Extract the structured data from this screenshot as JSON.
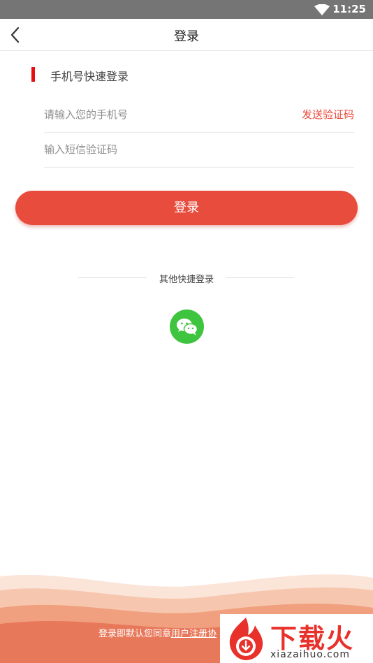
{
  "status_bar": {
    "time": "11:25",
    "wifi_icon": "wifi-icon"
  },
  "header": {
    "title": "登录",
    "back_icon": "back-arrow-icon"
  },
  "section": {
    "title": "手机号快速登录",
    "marker_color": "#e80e0e"
  },
  "form": {
    "phone_placeholder": "请输入您的手机号",
    "phone_value": "",
    "send_code_label": "发送验证码",
    "code_placeholder": "输入短信验证码",
    "code_value": ""
  },
  "login_button": {
    "label": "登录",
    "color": "#e84c3d"
  },
  "other_login": {
    "title": "其他快捷登录",
    "wechat_icon": "wechat-icon",
    "wechat_color": "#3ec43e"
  },
  "footer": {
    "agreement_prefix": "登录即默认您同意",
    "agreement_link": "用户注册协"
  },
  "watermark": {
    "text": "下载火",
    "url": "xiazaihuo.com",
    "logo_icon": "flame-logo-icon"
  }
}
